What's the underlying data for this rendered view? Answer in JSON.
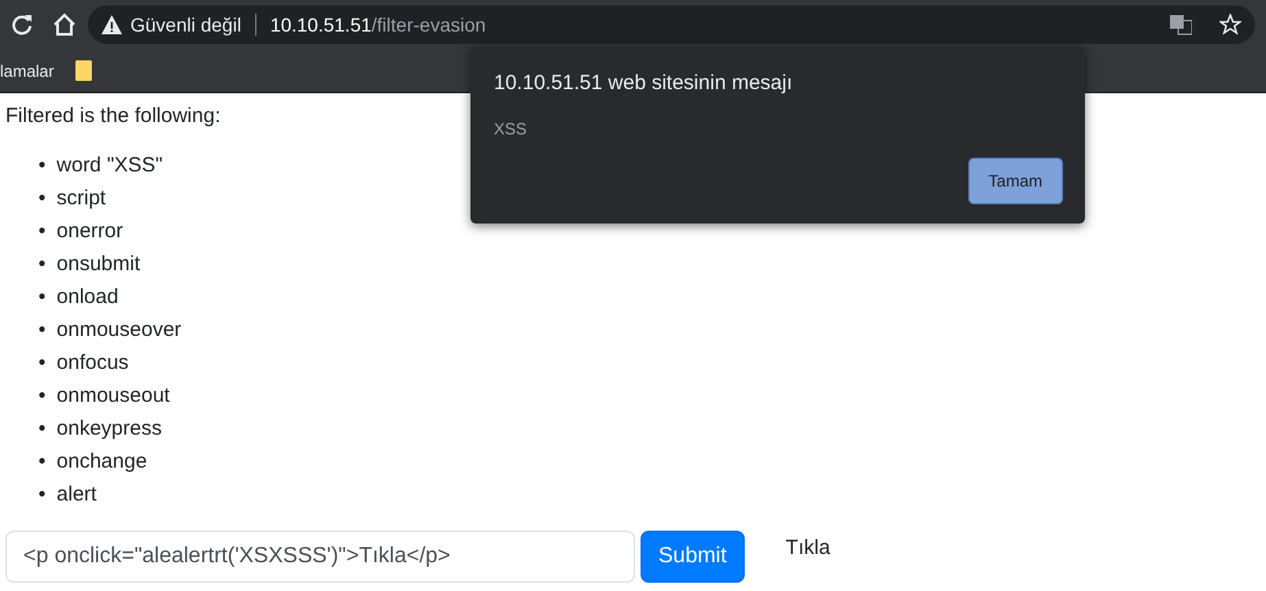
{
  "browser": {
    "security_label": "Güvenli değil",
    "url_host": "10.10.51.51",
    "url_path": "/filter-evasion"
  },
  "bookmarks_bar": {
    "items": [
      {
        "label": "lamalar",
        "kind": "text"
      },
      {
        "kind": "folder"
      }
    ]
  },
  "page": {
    "intro": "Filtered is the following:",
    "filtered": [
      {
        "bullet": "•",
        "text": "word \"XSS\""
      },
      {
        "bullet": "•",
        "text": "script"
      },
      {
        "bullet": "•",
        "text": "onerror"
      },
      {
        "bullet": "•",
        "text": "onsubmit"
      },
      {
        "bullet": "•",
        "text": "onload"
      },
      {
        "bullet": "•",
        "text": "onmouseover"
      },
      {
        "bullet": "•",
        "text": "onfocus"
      },
      {
        "bullet": "•",
        "text": "onmouseout"
      },
      {
        "bullet": "•",
        "text": "onkeypress"
      },
      {
        "bullet": "•",
        "text": "onchange"
      },
      {
        "bullet": "•",
        "text": "alert"
      }
    ],
    "form": {
      "value": "<p onclick=\"alealertrt('XSXSSS')\">Tıkla</p>",
      "button": "Submit"
    },
    "output": "Tıkla"
  },
  "dialog": {
    "title": "10.10.51.51 web sitesinin mesajı",
    "message": "XSS",
    "button": "Tamam"
  }
}
